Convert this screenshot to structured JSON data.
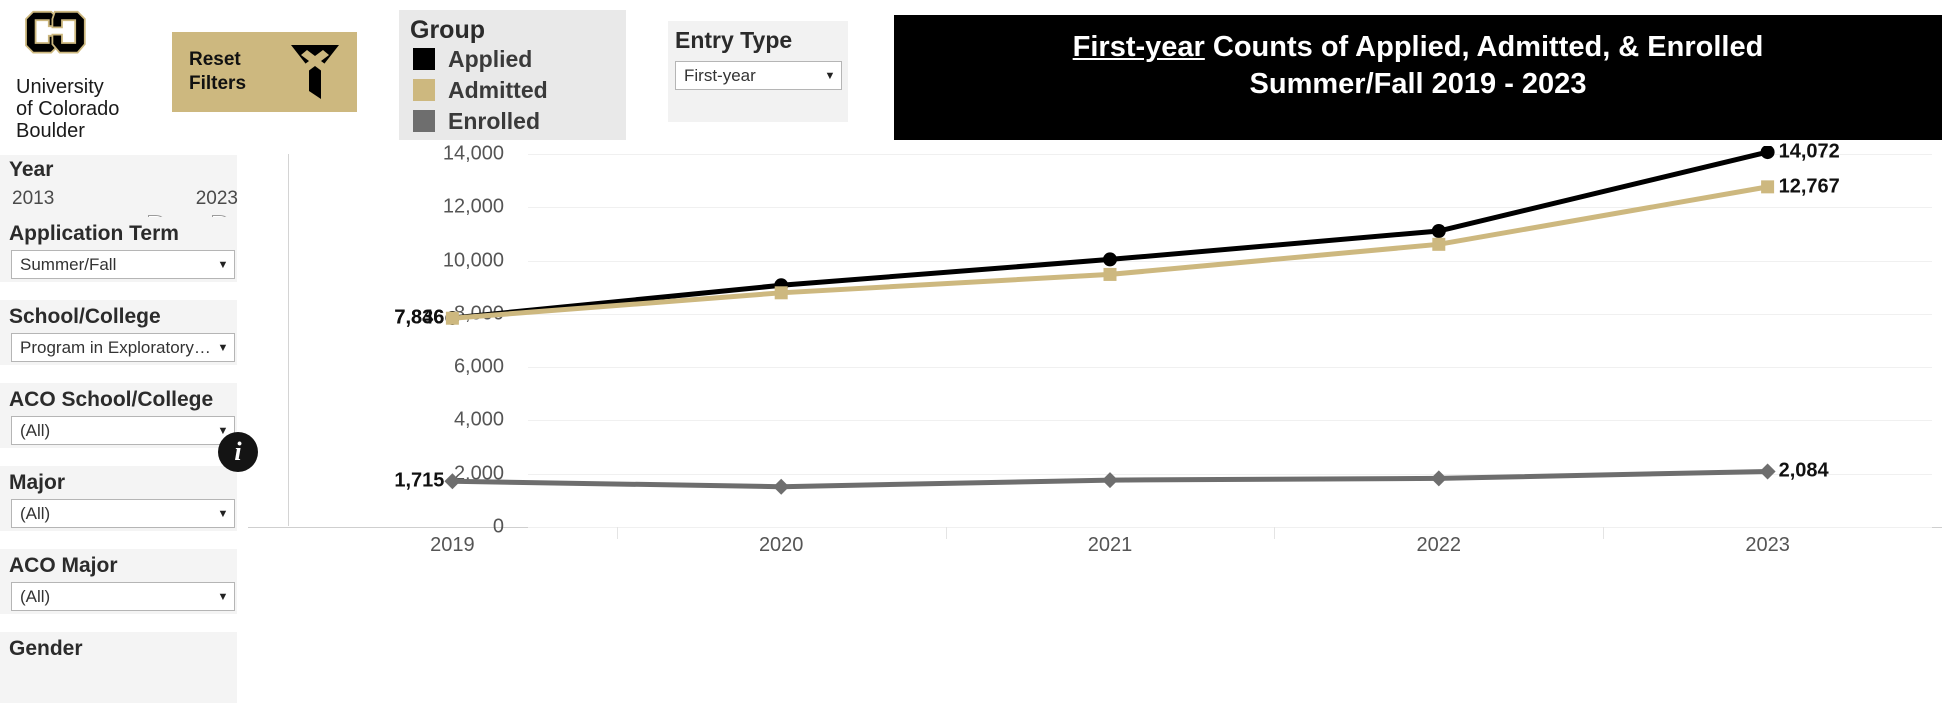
{
  "brand": {
    "logo_icon": "cu-boulder-logo",
    "name_lines": [
      "University",
      "of Colorado",
      "Boulder"
    ]
  },
  "toolbar": {
    "reset_label": "Reset\nFilters",
    "reset_line1": "Reset",
    "reset_line2": "Filters",
    "reset_icon": "filter-clear-icon",
    "reset_bg": "#cdb87f"
  },
  "legend": {
    "title": "Group",
    "items": [
      {
        "label": "Applied",
        "color": "#000000"
      },
      {
        "label": "Admitted",
        "color": "#cdb87f"
      },
      {
        "label": "Enrolled",
        "color": "#6e6e6e"
      }
    ]
  },
  "entry_type": {
    "title": "Entry Type",
    "value": "First-year",
    "caret_icon": "chevron-down-icon"
  },
  "header": {
    "title_emphasis": "First-year",
    "title_rest": " Counts of Applied, Admitted, & Enrolled",
    "subtitle": "Summer/Fall 2019 - 2023",
    "bg": "#000000",
    "fg": "#ffffff"
  },
  "sidebar": {
    "year": {
      "label": "Year",
      "min": "2013",
      "max": "2023"
    },
    "filters": [
      {
        "label": "Application Term",
        "value": "Summer/Fall"
      },
      {
        "label": "School/College",
        "value": "Program in Exploratory…"
      },
      {
        "label": "ACO School/College",
        "value": "(All)",
        "info_icon": "info-icon"
      },
      {
        "label": "Major",
        "value": "(All)"
      },
      {
        "label": "ACO Major",
        "value": "(All)"
      },
      {
        "label": "Gender",
        "value": ""
      }
    ]
  },
  "chart_data": {
    "type": "line",
    "title": "First-year Counts of Applied, Admitted, & Enrolled Summer/Fall 2019 - 2023",
    "xlabel": "",
    "ylabel": "",
    "categories": [
      "2019",
      "2020",
      "2021",
      "2022",
      "2023"
    ],
    "yticks": [
      "0",
      "2,000",
      "4,000",
      "6,000",
      "8,000",
      "10,000",
      "12,000",
      "14,000"
    ],
    "ylim": [
      0,
      14000
    ],
    "grid": true,
    "legend_position": "top-left-external",
    "series": [
      {
        "name": "Applied",
        "color": "#000000",
        "marker": "circle",
        "values": [
          7846,
          9073,
          10043,
          11110,
          14072
        ],
        "endpoint_labels": {
          "first": "7,846",
          "last": "14,072"
        }
      },
      {
        "name": "Admitted",
        "color": "#cdb87f",
        "marker": "square",
        "values": [
          7836,
          8790,
          9480,
          10610,
          12767
        ],
        "endpoint_labels": {
          "first": "7,836",
          "last": "12,767"
        }
      },
      {
        "name": "Enrolled",
        "color": "#6e6e6e",
        "marker": "diamond",
        "values": [
          1715,
          1512,
          1760,
          1825,
          2084
        ],
        "endpoint_labels": {
          "first": "1,715",
          "last": "2,084"
        }
      }
    ]
  }
}
